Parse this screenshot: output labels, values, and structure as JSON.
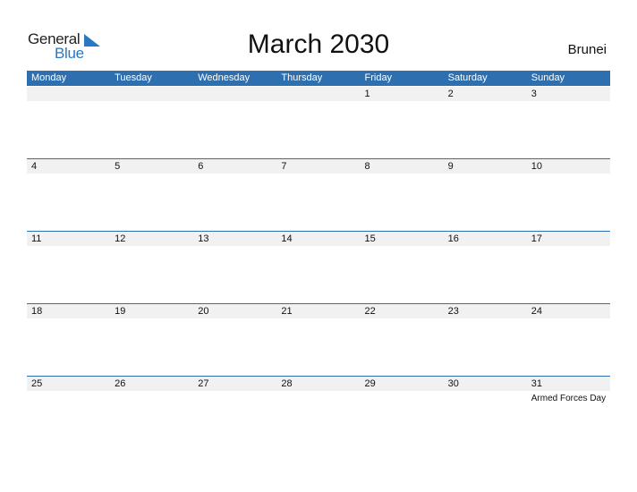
{
  "logo": {
    "text_general": "General",
    "text_blue": "Blue",
    "brand_color": "#2a78c2"
  },
  "title": "March 2030",
  "country": "Brunei",
  "colors": {
    "header_bg": "#2e6fb0",
    "row_band": "#f1f1f1"
  },
  "weekdays": [
    "Monday",
    "Tuesday",
    "Wednesday",
    "Thursday",
    "Friday",
    "Saturday",
    "Sunday"
  ],
  "weeks": [
    {
      "days": [
        {
          "date": ""
        },
        {
          "date": ""
        },
        {
          "date": ""
        },
        {
          "date": ""
        },
        {
          "date": "1"
        },
        {
          "date": "2"
        },
        {
          "date": "3"
        }
      ]
    },
    {
      "days": [
        {
          "date": "4"
        },
        {
          "date": "5"
        },
        {
          "date": "6"
        },
        {
          "date": "7"
        },
        {
          "date": "8"
        },
        {
          "date": "9"
        },
        {
          "date": "10"
        }
      ]
    },
    {
      "days": [
        {
          "date": "11"
        },
        {
          "date": "12"
        },
        {
          "date": "13"
        },
        {
          "date": "14"
        },
        {
          "date": "15"
        },
        {
          "date": "16"
        },
        {
          "date": "17"
        }
      ]
    },
    {
      "days": [
        {
          "date": "18"
        },
        {
          "date": "19"
        },
        {
          "date": "20"
        },
        {
          "date": "21"
        },
        {
          "date": "22"
        },
        {
          "date": "23"
        },
        {
          "date": "24"
        }
      ]
    },
    {
      "days": [
        {
          "date": "25"
        },
        {
          "date": "26"
        },
        {
          "date": "27"
        },
        {
          "date": "28"
        },
        {
          "date": "29"
        },
        {
          "date": "30"
        },
        {
          "date": "31",
          "event": "Armed Forces Day"
        }
      ]
    }
  ]
}
